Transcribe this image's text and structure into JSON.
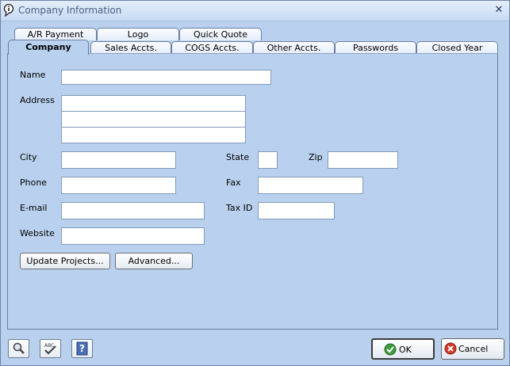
{
  "window": {
    "title": "Company Information",
    "close_glyph": "✕"
  },
  "tabs_back": [
    "A/R Payment",
    "Logo",
    "Quick Quote"
  ],
  "tabs_front": [
    "Company",
    "Sales Accts.",
    "COGS Accts.",
    "Other Accts.",
    "Passwords",
    "Closed Year"
  ],
  "active_tab": "Company",
  "form": {
    "name_label": "Name",
    "address_label": "Address",
    "city_label": "City",
    "state_label": "State",
    "zip_label": "Zip",
    "phone_label": "Phone",
    "fax_label": "Fax",
    "email_label": "E-mail",
    "taxid_label": "Tax ID",
    "website_label": "Website",
    "name": "",
    "address1": "",
    "address2": "",
    "address3": "",
    "city": "",
    "state": "",
    "zip": "",
    "phone": "",
    "fax": "",
    "email": "",
    "taxid": "",
    "website": ""
  },
  "buttons": {
    "update_projects": "Update Projects...",
    "advanced": "Advanced...",
    "ok": "OK",
    "cancel": "Cancel"
  },
  "icons": [
    "app-info-icon",
    "search-icon",
    "spellcheck-icon",
    "help-icon",
    "ok-check-icon",
    "cancel-icon"
  ]
}
